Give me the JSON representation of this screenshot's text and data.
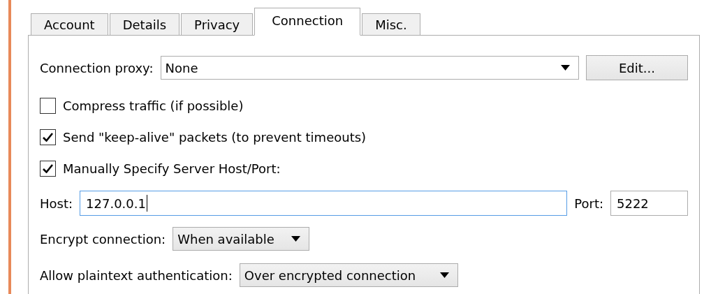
{
  "tabs": [
    {
      "label": "Account",
      "selected": false
    },
    {
      "label": "Details",
      "selected": false
    },
    {
      "label": "Privacy",
      "selected": false
    },
    {
      "label": "Connection",
      "selected": true
    },
    {
      "label": "Misc.",
      "selected": false
    }
  ],
  "proxy": {
    "label": "Connection proxy:",
    "value": "None",
    "button": "Edit..."
  },
  "options": [
    {
      "label": "Compress traffic (if possible)",
      "checked": false
    },
    {
      "label": "Send \"keep-alive\" packets (to prevent timeouts)",
      "checked": true
    },
    {
      "label": "Manually Specify Server Host/Port:",
      "checked": true
    }
  ],
  "host": {
    "label": "Host:",
    "value": "127.0.0.1",
    "focused": true
  },
  "port": {
    "label": "Port:",
    "value": "5222"
  },
  "encrypt": {
    "label": "Encrypt connection:",
    "value": "When available"
  },
  "plaintext": {
    "label": "Allow plaintext authentication:",
    "value": "Over encrypted connection"
  }
}
